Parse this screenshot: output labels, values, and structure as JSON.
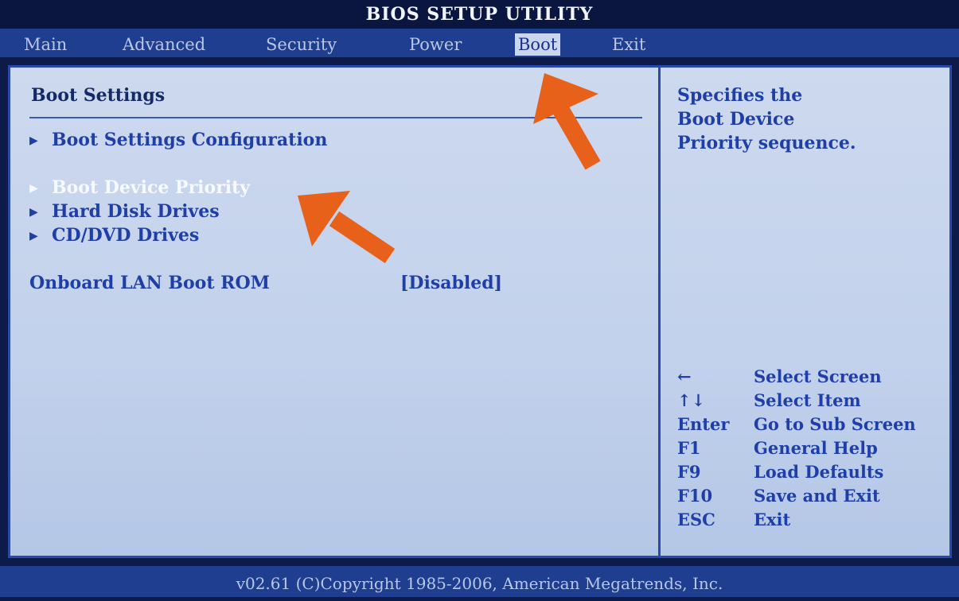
{
  "title": "BIOS SETUP UTILITY",
  "menu": [
    {
      "label": "Main"
    },
    {
      "label": "Advanced"
    },
    {
      "label": "Security"
    },
    {
      "label": "Power"
    },
    {
      "label": "Boot",
      "active": true
    },
    {
      "label": "Exit"
    }
  ],
  "panel": {
    "heading": "Boot Settings",
    "items": [
      {
        "label": "Boot Settings Configuration"
      },
      {
        "label": "Boot Device Priority",
        "selected": true
      },
      {
        "label": "Hard Disk Drives"
      },
      {
        "label": "CD/DVD Drives"
      }
    ],
    "lan": {
      "label": "Onboard LAN Boot ROM",
      "value": "[Disabled]"
    }
  },
  "help": {
    "lines": [
      "Specifies the",
      "Boot Device",
      "Priority sequence."
    ]
  },
  "keys": [
    {
      "key": "←",
      "desc": "Select Screen"
    },
    {
      "key": "↑↓",
      "desc": "Select Item"
    },
    {
      "key": "Enter",
      "desc": "Go to Sub Screen"
    },
    {
      "key": "F1",
      "desc": "General Help"
    },
    {
      "key": "F9",
      "desc": "Load Defaults"
    },
    {
      "key": "F10",
      "desc": "Save and Exit"
    },
    {
      "key": "ESC",
      "desc": "Exit"
    }
  ],
  "footer": "v02.61 (C)Copyright 1985-2006, American Megatrends, Inc.",
  "colors": {
    "annotation_arrow": "#e8611a",
    "highlight_text": "#f6f9ff",
    "item_text": "#1f3fa6"
  }
}
